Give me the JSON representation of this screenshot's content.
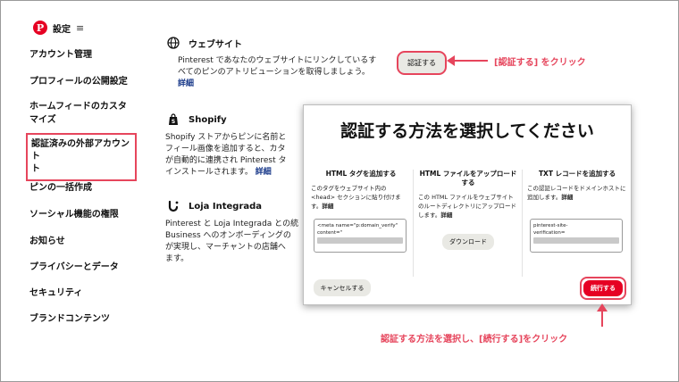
{
  "header": {
    "logo": "P",
    "title": "設定",
    "menu_icon": "≡"
  },
  "sidebar": {
    "items": [
      {
        "label": "アカウント管理"
      },
      {
        "label": "プロフィールの公開設定"
      },
      {
        "label": "ホームフィードのカスタ"
      },
      {
        "label": "マイズ"
      },
      {
        "label": "認証済みの外部アカウント"
      },
      {
        "label": "ト"
      },
      {
        "label": "ピンの一括作成"
      },
      {
        "label": "ソーシャル機能の権限"
      },
      {
        "label": "お知らせ"
      },
      {
        "label": "プライバシーとデータ"
      },
      {
        "label": "セキュリティ"
      },
      {
        "label": "ブランドコンテンツ"
      }
    ]
  },
  "main": {
    "website": {
      "title": "ウェブサイト",
      "desc1": "Pinterest であなたのウェブサイトにリンクしているす",
      "desc2": "べてのピンのアトリビューションを取得しましょう。",
      "link": "詳細",
      "button_line1": "認証する",
      "button_line2": ""
    },
    "shopify": {
      "title": "Shopify",
      "desc1": "Shopify ストアからピンに名前と",
      "desc2": "フィール画像を追加すると、カタ",
      "desc3": "が自動的に連携され Pinterest タ",
      "desc4": "インストールされます。",
      "link": "詳細"
    },
    "loja": {
      "title": "Loja Integrada",
      "desc1": "Pinterest と Loja Integrada との統",
      "desc2": "Business へのオンボーディングの",
      "desc3": "が実現し、マーチャントの店舗へ",
      "desc4": "ます。"
    }
  },
  "annotations": {
    "verify": "[認証する] をクリック",
    "continue": "認証する方法を選択し、[続行する]をクリック"
  },
  "modal": {
    "title": "認証する方法を選択してください",
    "columns": [
      {
        "title": "HTML タグを追加する",
        "desc": "このタグをウェブサイト内の <head> セクションに貼り付けます。",
        "link": "詳細",
        "code1": "<meta name=\"p:domain_verify\"",
        "code2": "content=\""
      },
      {
        "title": "HTML ファイルをアップロードする",
        "desc": "この HTML ファイルをウェブサイトのルートディレクトリにアップロードします。",
        "link": "詳細",
        "button": "ダウンロード"
      },
      {
        "title": "TXT レコードを追加する",
        "desc": "この認証レコードをドメインホストに追加します。",
        "link": "詳細",
        "code1": "pinterest-site-",
        "code2": "verification="
      }
    ],
    "cancel": "キャンセルする",
    "continue": "続行する"
  },
  "colors": {
    "accent": "#e60023",
    "annotation": "#e6455c",
    "link": "#1a3a8a"
  }
}
